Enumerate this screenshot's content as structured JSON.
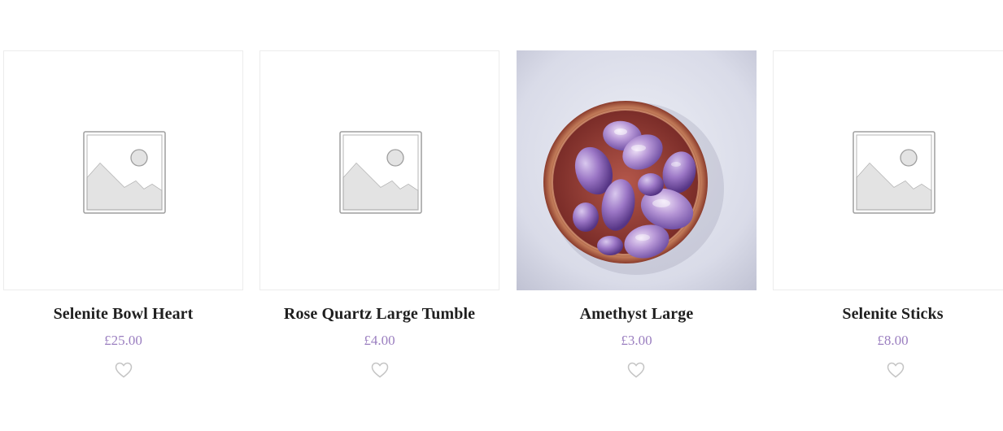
{
  "products": [
    {
      "name": "Selenite Bowl Heart",
      "price": "£25.00",
      "image": "placeholder-image-icon"
    },
    {
      "name": "Rose Quartz Large Tumble",
      "price": "£4.00",
      "image": "placeholder-image-icon"
    },
    {
      "name": "Amethyst Large",
      "price": "£3.00",
      "image": "amethyst-tumbled-stones-in-copper-bowl-photo"
    },
    {
      "name": "Selenite Sticks",
      "price": "£8.00",
      "image": "placeholder-image-icon"
    }
  ],
  "wishlist_icon": "heart-outline-icon",
  "colors": {
    "price": "#9b7fc0",
    "title": "#1f1f1f",
    "placeholder_stroke": "#a8a8a8",
    "placeholder_fill": "#e2e2e2",
    "heart_stroke": "#c4c4c4"
  }
}
